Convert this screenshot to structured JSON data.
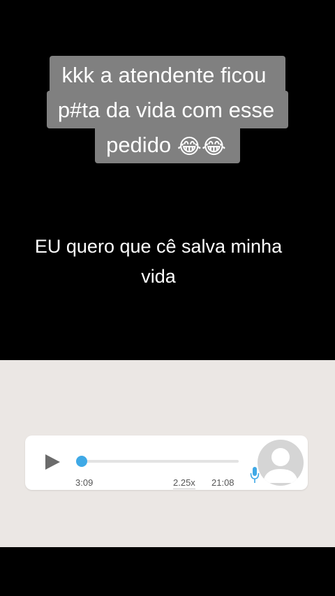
{
  "caption": {
    "line1": "kkk a atendente ficou",
    "line2": "p#ta da vida com esse",
    "line3": "pedido",
    "emoji": "😂😂"
  },
  "subtitle": {
    "line1": "EU quero que cê salva minha",
    "line2": "vida"
  },
  "voice_message": {
    "progress": 0,
    "elapsed": "3:09",
    "speed": "2.25x",
    "duration": "21:08",
    "accent_color": "#3fa9e6",
    "play_icon": "play-icon",
    "mic_icon": "mic-icon",
    "avatar_icon": "default-avatar-icon"
  }
}
